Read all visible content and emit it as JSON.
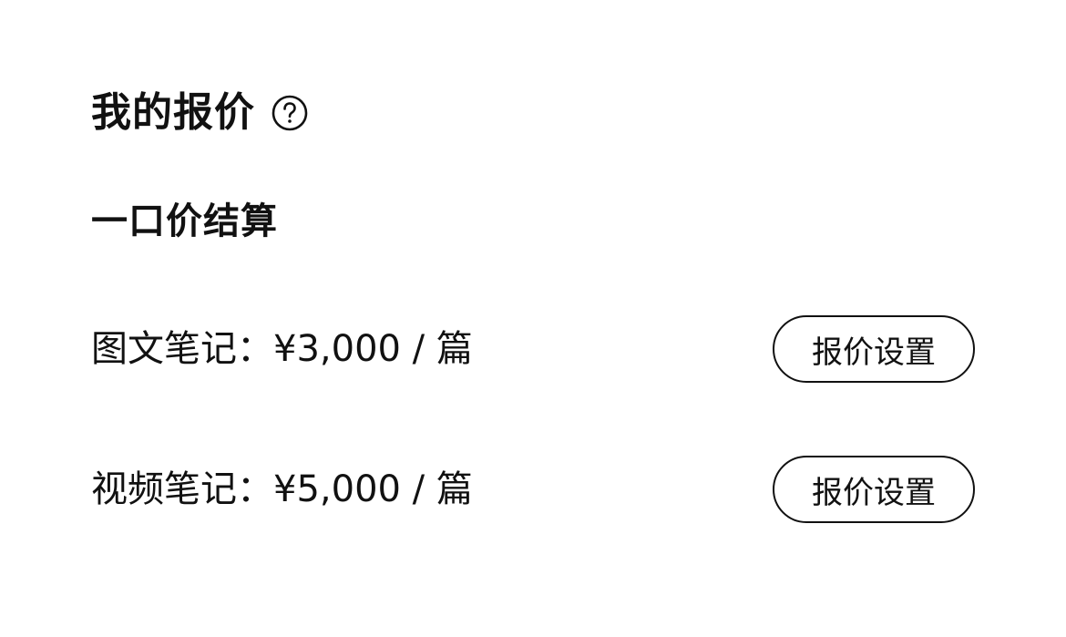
{
  "header": {
    "title": "我的报价",
    "help_icon": "question-circle-icon"
  },
  "section": {
    "title": "一口价结算"
  },
  "prices": [
    {
      "label": "图文笔记：",
      "amount": "¥3,000",
      "unit": " / 篇",
      "button_label": "报价设置"
    },
    {
      "label": "视频笔记：",
      "amount": "¥5,000",
      "unit": " / 篇",
      "button_label": "报价设置"
    }
  ],
  "colors": {
    "text": "#111111",
    "background": "#ffffff"
  }
}
